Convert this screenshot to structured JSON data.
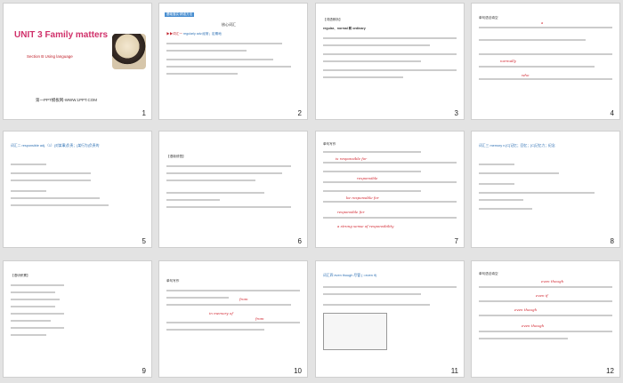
{
  "slides": [
    {
      "num": "1",
      "title": "UNIT 3  Family matters",
      "subtitle": "Section B    Using language",
      "footer": "第一PPT模板网-WWW.1PPT.COM"
    },
    {
      "num": "2",
      "head": "核心词汇",
      "sub_red": "▶▶词汇一",
      "sub_text": "regularly  adv.经常；定期地"
    },
    {
      "num": "3",
      "head": "【词语辨析】",
      "line1": "regular、normal 和 ordinary"
    },
    {
      "num": "4",
      "head": "单句语法填空"
    },
    {
      "num": "5",
      "head": "词汇二  responsible adj.（1）(对某事)负责；(某行为)负责的"
    },
    {
      "num": "6",
      "head": "【语境领悟】"
    },
    {
      "num": "7",
      "head": "单句写作"
    },
    {
      "num": "8",
      "head": "词汇三  memory n.[C]记忆；回忆；[C]记忆力；纪念"
    },
    {
      "num": "9",
      "head": "【语块积累】"
    },
    {
      "num": "10",
      "head": "单句写作"
    },
    {
      "num": "11",
      "head": "词汇四  even though 尽管 ( =even if)"
    },
    {
      "num": "12",
      "head": "单句语法填空"
    }
  ],
  "annotations": {
    "s4_a": "a",
    "s4_b": "normally",
    "s4_c": "who",
    "s7_a": "is responsible for",
    "s7_b": "responsible",
    "s7_c": "be responsible for",
    "s7_d": "responsible for",
    "s7_e": "a strong sense of responsibility",
    "s10_a": "from",
    "s10_b": "in memory of",
    "s10_c": "from",
    "s12_a": "even though",
    "s12_b": "even if",
    "s12_c": "even though",
    "s12_d": "even though"
  }
}
